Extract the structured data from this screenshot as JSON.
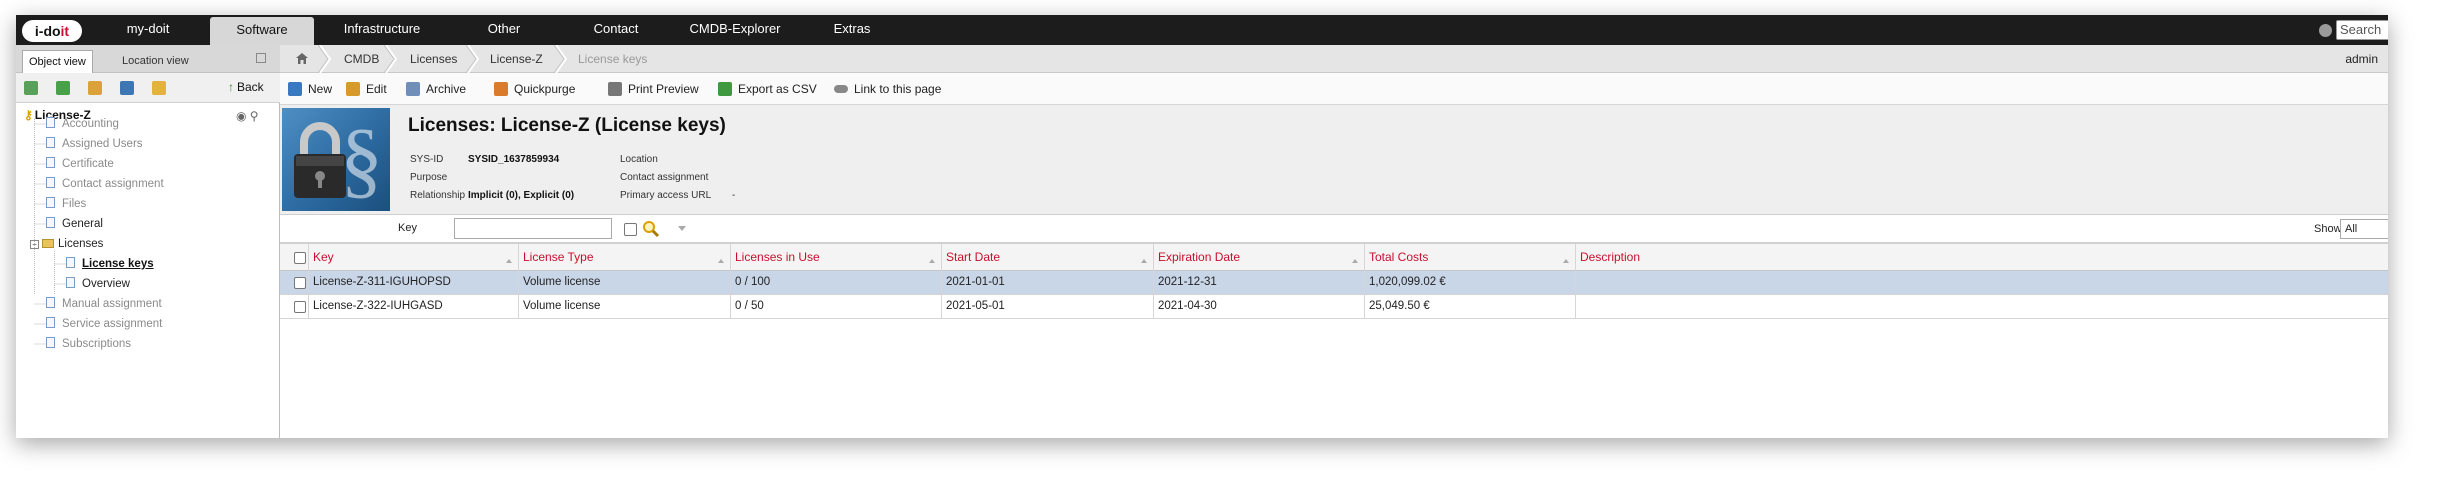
{
  "topnav": {
    "logo": {
      "text_i": "i-do",
      "text_it": "it"
    },
    "items": [
      {
        "label": "my-doit",
        "active": false
      },
      {
        "label": "Software",
        "active": true
      },
      {
        "label": "Infrastructure",
        "active": false
      },
      {
        "label": "Other",
        "active": false
      },
      {
        "label": "Contact",
        "active": false
      },
      {
        "label": "CMDB-Explorer",
        "active": false
      },
      {
        "label": "Extras",
        "active": false
      }
    ],
    "search_placeholder": "Search"
  },
  "leftpanel": {
    "tabs": [
      {
        "label": "Object view",
        "active": true
      },
      {
        "label": "Location view",
        "active": false
      }
    ],
    "back_label": "Back",
    "tree": {
      "root": "License-Z",
      "items": [
        {
          "label": "Accounting",
          "state": "inactive"
        },
        {
          "label": "Assigned Users",
          "state": "inactive"
        },
        {
          "label": "Certificate",
          "state": "inactive"
        },
        {
          "label": "Contact assignment",
          "state": "inactive"
        },
        {
          "label": "Files",
          "state": "inactive"
        },
        {
          "label": "General",
          "state": "active"
        },
        {
          "label": "Licenses",
          "state": "folder"
        },
        {
          "label": "License keys",
          "state": "selected"
        },
        {
          "label": "Overview",
          "state": "active"
        },
        {
          "label": "Manual assignment",
          "state": "inactive"
        },
        {
          "label": "Service assignment",
          "state": "inactive"
        },
        {
          "label": "Subscriptions",
          "state": "inactive"
        }
      ]
    }
  },
  "breadcrumb": {
    "items": [
      "CMDB",
      "Licenses",
      "License-Z",
      "License keys"
    ],
    "user": "admin"
  },
  "actions": [
    {
      "label": "New",
      "icon": "new-document-icon",
      "color": "#3a78c2"
    },
    {
      "label": "Edit",
      "icon": "edit-icon",
      "color": "#d69a2a"
    },
    {
      "label": "Archive",
      "icon": "archive-icon",
      "color": "#6f8fb8"
    },
    {
      "label": "Quickpurge",
      "icon": "quickpurge-icon",
      "color": "#d97b2b"
    },
    {
      "label": "Print Preview",
      "icon": "printer-icon",
      "color": "#777777"
    },
    {
      "label": "Export as CSV",
      "icon": "csv-export-icon",
      "color": "#3f9a3f"
    },
    {
      "label": "Link to this page",
      "icon": "link-icon",
      "color": "#888888"
    }
  ],
  "object": {
    "title": "Licenses: License-Z (License keys)",
    "image_icon": "padlock-paragraph-icon",
    "meta": {
      "sysid_label": "SYS-ID",
      "sysid_value": "SYSID_1637859934",
      "purpose_label": "Purpose",
      "purpose_value": "",
      "relationship_label": "Relationship",
      "relationship_value": "Implicit (0), Explicit (0)",
      "location_label": "Location",
      "contact_label": "Contact assignment",
      "access_label": "Primary access URL",
      "access_value": "-"
    }
  },
  "filter": {
    "key_label": "Key",
    "key_value": "",
    "show_label": "Show",
    "show_value": "All"
  },
  "table": {
    "columns": [
      "Key",
      "License Type",
      "Licenses in Use",
      "Start Date",
      "Expiration Date",
      "Total Costs",
      "Description"
    ],
    "rows": [
      {
        "cells": [
          "License-Z-311-IGUHOPSD",
          "Volume license",
          "0 / 100",
          "2021-01-01",
          "2021-12-31",
          "1,020,099.02 €",
          ""
        ],
        "selected": true
      },
      {
        "cells": [
          "License-Z-322-IUHGASD",
          "Volume license",
          "0 / 50",
          "2021-05-01",
          "2021-04-30",
          "25,049.50 €",
          ""
        ],
        "selected": false
      }
    ]
  },
  "colors": {
    "header_bar": "#1c1c1c",
    "column_header_text": "#c8102e",
    "selected_row": "#c9d6e8"
  }
}
